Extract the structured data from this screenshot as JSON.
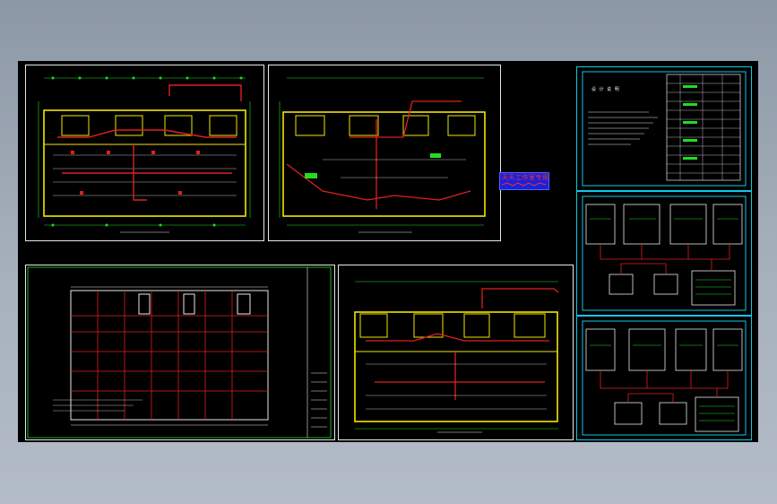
{
  "stamp": {
    "title": "天天工作室专用",
    "subtitle_color": "#ff2a2a",
    "background": "#1a22d8"
  },
  "notes": {
    "title": "设 计 说 明"
  },
  "colors": {
    "background_top": "#8d98a6",
    "canvas": "#000000",
    "wall": "#f2e600",
    "route": "#e02020",
    "grid": "#22dd22",
    "frame_cyan": "#10c8e8",
    "frame_white": "#e8e8e8"
  },
  "sheets": [
    {
      "id": "sheet-floor-plan-1",
      "type": "floor-plan"
    },
    {
      "id": "sheet-floor-plan-2",
      "type": "floor-plan"
    },
    {
      "id": "sheet-grid-plan",
      "type": "structural-grid"
    },
    {
      "id": "sheet-floor-plan-3",
      "type": "floor-plan"
    },
    {
      "id": "sheet-design-notes",
      "type": "notes-table"
    },
    {
      "id": "sheet-system-diagram-1",
      "type": "distribution-diagram"
    },
    {
      "id": "sheet-system-diagram-2",
      "type": "distribution-diagram"
    }
  ]
}
